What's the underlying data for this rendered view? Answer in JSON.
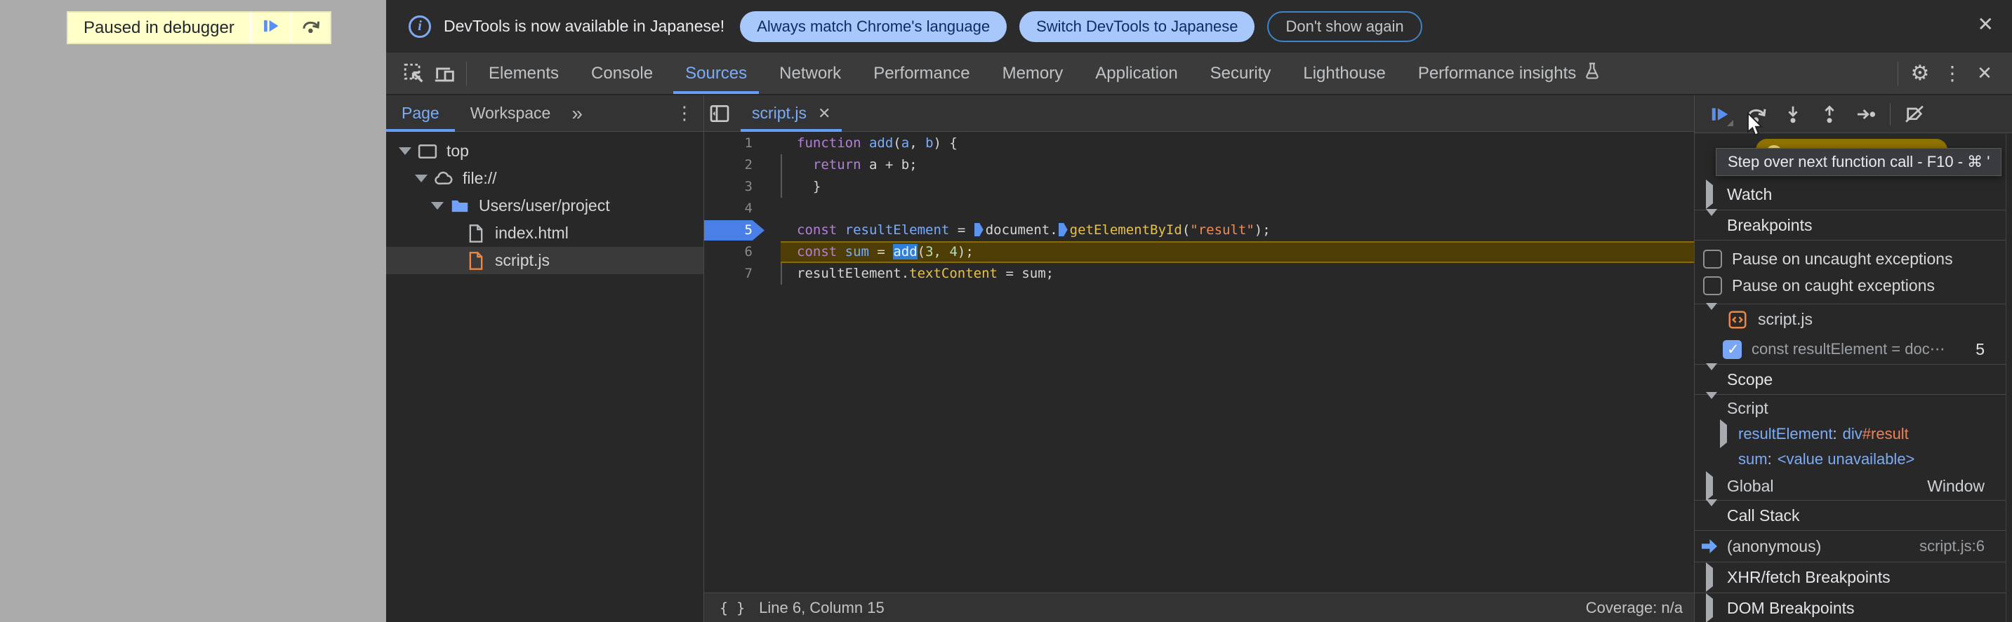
{
  "colors": {
    "accent_blue": "#7cacf8",
    "tab_underline": "#669df6",
    "paused_toolbar_bg": "#ffffca",
    "notification_pill_bg": "#a8c7fa",
    "paused_line_bg": "#4e3d05",
    "exec_line_marker": "#4b7fe8",
    "keyword_purple": "#b57edb",
    "function_yellow": "#e8c04a",
    "string_orange": "#f28b54",
    "number_green": "#b8ddb8",
    "panel_bg": "#282828",
    "toolbar_bg": "#333333"
  },
  "icons": {
    "close": "✕",
    "gear": "⚙",
    "kebab": "⋮",
    "more_tabs": "»",
    "info": "i"
  },
  "paused_overlay": {
    "label": "Paused in debugger"
  },
  "notification": {
    "message": "DevTools is now available in Japanese!",
    "actions": [
      {
        "label": "Always match Chrome's language",
        "style": "filled"
      },
      {
        "label": "Switch DevTools to Japanese",
        "style": "filled"
      },
      {
        "label": "Don't show again",
        "style": "outline"
      }
    ]
  },
  "main_tabs": {
    "tabs": [
      {
        "label": "Elements"
      },
      {
        "label": "Console"
      },
      {
        "label": "Sources",
        "active": true
      },
      {
        "label": "Network"
      },
      {
        "label": "Performance"
      },
      {
        "label": "Memory"
      },
      {
        "label": "Application"
      },
      {
        "label": "Security"
      },
      {
        "label": "Lighthouse"
      },
      {
        "label": "Performance insights",
        "flask": true
      }
    ]
  },
  "sidebar": {
    "tabs": [
      {
        "label": "Page",
        "active": true
      },
      {
        "label": "Workspace"
      }
    ],
    "tree": [
      {
        "label": "top",
        "depth": 0,
        "icon": "frame",
        "arrow": "down"
      },
      {
        "label": "file://",
        "depth": 1,
        "icon": "cloud",
        "arrow": "down"
      },
      {
        "label": "Users/user/project",
        "depth": 2,
        "icon": "folder",
        "arrow": "down"
      },
      {
        "label": "index.html",
        "depth": 3,
        "icon": "file-html",
        "arrow": "none"
      },
      {
        "label": "script.js",
        "depth": 3,
        "icon": "file-js",
        "arrow": "none",
        "selected": true
      }
    ]
  },
  "editor": {
    "open_tab": {
      "label": "script.js",
      "close": "✕"
    },
    "lines": [
      {
        "n": 1,
        "tokens": [
          [
            "kw",
            "function"
          ],
          [
            "pl",
            " "
          ],
          [
            "blue",
            "add"
          ],
          [
            "pl",
            "("
          ],
          [
            "blue",
            "a"
          ],
          [
            "pl",
            ", "
          ],
          [
            "blue",
            "b"
          ],
          [
            "pl",
            ") {"
          ]
        ]
      },
      {
        "n": 2,
        "guide": true,
        "tokens": [
          [
            "pl",
            "  "
          ],
          [
            "kw",
            "return"
          ],
          [
            "pl",
            " a + b;"
          ]
        ]
      },
      {
        "n": 3,
        "guide": true,
        "tokens": [
          [
            "pl",
            "  }"
          ]
        ]
      },
      {
        "n": 4,
        "tokens": []
      },
      {
        "n": 5,
        "exec": true,
        "tokens": [
          [
            "kw",
            "const"
          ],
          [
            "pl",
            " "
          ],
          [
            "blue",
            "resultElement"
          ],
          [
            "pl",
            " = "
          ],
          [
            "badge",
            ""
          ],
          [
            "pl",
            "document."
          ],
          [
            "badge",
            ""
          ],
          [
            "yellow",
            "getElementById"
          ],
          [
            "pl",
            "("
          ],
          [
            "str",
            "\"result\""
          ],
          [
            "pl",
            ");"
          ]
        ]
      },
      {
        "n": 6,
        "paused": true,
        "tokens": [
          [
            "kw",
            "const"
          ],
          [
            "pl",
            " "
          ],
          [
            "blue",
            "sum"
          ],
          [
            "pl",
            " = "
          ],
          [
            "sel",
            "add"
          ],
          [
            "pl",
            "("
          ],
          [
            "num",
            "3"
          ],
          [
            "pl",
            ", "
          ],
          [
            "num",
            "4"
          ],
          [
            "pl",
            ");"
          ]
        ]
      },
      {
        "n": 7,
        "guide": true,
        "tokens": [
          [
            "pl",
            "resultElement."
          ],
          [
            "yellow",
            "textContent"
          ],
          [
            "pl",
            " = sum;"
          ]
        ]
      }
    ],
    "status": {
      "pretty_print": "{ }",
      "position": "Line 6, Column 15",
      "coverage": "Coverage: n/a"
    }
  },
  "debugger_panel": {
    "tooltip": "Step over next function call - F10 - ⌘ '",
    "toolbar_buttons": [
      "resume",
      "step-over",
      "step-into",
      "step-out",
      "step",
      "deactivate-breakpoints"
    ],
    "rows": [
      {
        "type": "header",
        "label": "Watch",
        "arrow": "right"
      },
      {
        "type": "header",
        "label": "Breakpoints",
        "arrow": "down",
        "divider": "top-bottom"
      },
      {
        "type": "checkbox",
        "label": "Pause on uncaught exceptions",
        "checked": false,
        "pos": "first"
      },
      {
        "type": "checkbox",
        "label": "Pause on caught exceptions",
        "checked": false,
        "pos": "last"
      },
      {
        "type": "group",
        "label": "script.js",
        "arrow": "down",
        "icon": "script-file",
        "divider": "top"
      },
      {
        "type": "breakpoint",
        "label": "const resultElement = doc⋯",
        "checked": true,
        "right": "5"
      },
      {
        "type": "header",
        "label": "Scope",
        "arrow": "down",
        "divider": "top-bottom"
      },
      {
        "type": "subheader",
        "label": "Script",
        "arrow": "down"
      },
      {
        "type": "variable",
        "name": "resultElement",
        "arrow": "right",
        "value": [
          [
            "blue",
            "div"
          ],
          [
            "orange",
            "#result"
          ]
        ]
      },
      {
        "type": "variable",
        "name": "sum",
        "arrow": "none",
        "value": [
          [
            "blue",
            "<value unavailable>"
          ]
        ]
      },
      {
        "type": "subheader",
        "label": "Global",
        "arrow": "right",
        "right": "Window",
        "tall": true
      },
      {
        "type": "header",
        "label": "Call Stack",
        "arrow": "down",
        "divider": "top-bottom"
      },
      {
        "type": "stack",
        "label": "(anonymous)",
        "right": "script.js:6"
      },
      {
        "type": "header",
        "label": "XHR/fetch Breakpoints",
        "arrow": "right",
        "divider": "top"
      },
      {
        "type": "header",
        "label": "DOM Breakpoints",
        "arrow": "right",
        "divider": "top"
      }
    ]
  }
}
